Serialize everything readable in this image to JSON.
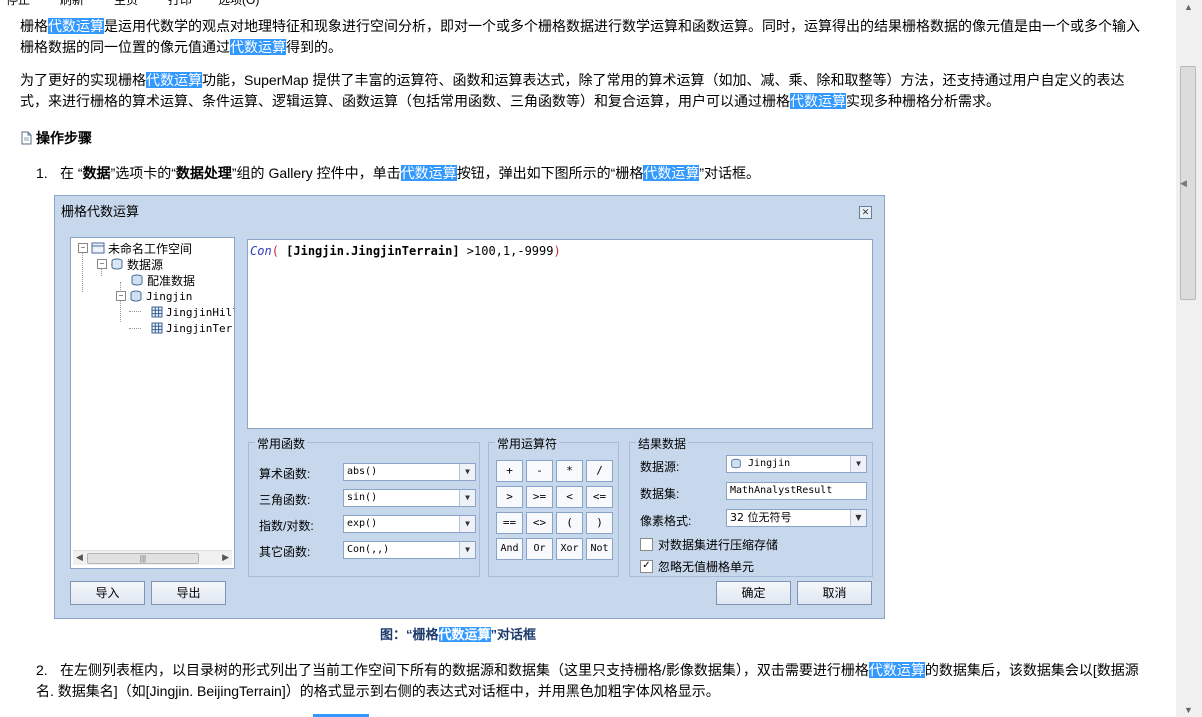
{
  "top_toolbar": [
    "停止",
    "刷新",
    "主页",
    "打印",
    "选项(O)"
  ],
  "intro": {
    "p1_a": "栅格",
    "p1_hl1": "代数运算",
    "p1_b": "是运用代数学的观点对地理特征和现象进行空间分析，即对一个或多个栅格数据进行数学运算和函数运算。同时，运算得出的结果栅格数据的像元值是由一个或多个输入栅格数据的同一位置的像元值通过",
    "p1_hl2": "代数运算",
    "p1_c": "得到的。",
    "p2_a": "为了更好的实现栅格",
    "p2_hl1": "代数运算",
    "p2_b": "功能，SuperMap 提供了丰富的运算符、函数和运算表达式，除了常用的算术运算（如加、减、乘、除和取整等）方法，还支持通过用户自定义的表达式，来进行栅格的算术运算、条件运算、逻辑运算、函数运算（包括常用函数、三角函数等）和复合运算，用户可以通过栅格",
    "p2_hl2": "代数运算",
    "p2_c": "实现多种栅格分析需求。"
  },
  "section_heading": "操作步骤",
  "step1": {
    "num": "1.",
    "a": "在 “",
    "b": "数据",
    "c": "”选项卡的“",
    "d": "数据处理",
    "e": "”组的 Gallery 控件中，单击",
    "hl": "代数运算",
    "f": "按钮，弹出如下图所示的“栅格",
    "hl2": "代数运算",
    "g": "”对话框。"
  },
  "dialog": {
    "title": "栅格代数运算",
    "tree": {
      "workspace": "未命名工作空间",
      "datasources": "数据源",
      "ds1": "配准数据",
      "ds2": "Jingjin",
      "set1": "JingjinHill",
      "set2": "JingjinTerr"
    },
    "expression": {
      "func": "Con",
      "open": "(",
      "dataset": "[Jingjin.JingjinTerrain]",
      "rest": " >100,1,-9999",
      "close": ")"
    },
    "common_functions": {
      "title": "常用函数",
      "rows": [
        {
          "label": "算术函数:",
          "value": "abs()"
        },
        {
          "label": "三角函数:",
          "value": "sin()"
        },
        {
          "label": "指数/对数:",
          "value": "exp()"
        },
        {
          "label": "其它函数:",
          "value": "Con(,,)"
        }
      ]
    },
    "operators": {
      "title": "常用运算符",
      "buttons": [
        "+",
        "-",
        "*",
        "/",
        ">",
        ">=",
        "<",
        "<=",
        "==",
        "<>",
        "(",
        ")",
        "And",
        "Or",
        "Xor",
        "Not"
      ]
    },
    "result": {
      "title": "结果数据",
      "datasource_label": "数据源:",
      "datasource_value": "Jingjin",
      "dataset_label": "数据集:",
      "dataset_value": "MathAnalystResult",
      "pixel_label": "像素格式:",
      "pixel_value": "32 位无符号",
      "compress_label": "对数据集进行压缩存储",
      "compress_checked": false,
      "ignore_label": "忽略无值栅格单元",
      "ignore_checked": true
    },
    "import_button": "导入",
    "export_button": "导出",
    "ok_button": "确定",
    "cancel_button": "取消"
  },
  "caption": {
    "a": "图：“栅格",
    "hl": "代数运算",
    "b": "”对话框"
  },
  "step2": {
    "num": "2.",
    "a": "在左侧列表框内，以目录树的形式列出了当前工作空间下所有的数据源和数据集（这里只支持栅格/影像数据集），双击需要进行栅格",
    "hl": "代数运算",
    "b": "的数据集后，该数据集会以[数据源名. 数据集名]（如[Jingjin. BeijingTerrain]）的格式显示到右侧的表达式对话框中，并用黑色加粗字体风格显示。"
  },
  "colors": {
    "highlight": "#3399ff",
    "dialog_bg": "#c7d7ec",
    "caption": "#1b3a6b"
  }
}
